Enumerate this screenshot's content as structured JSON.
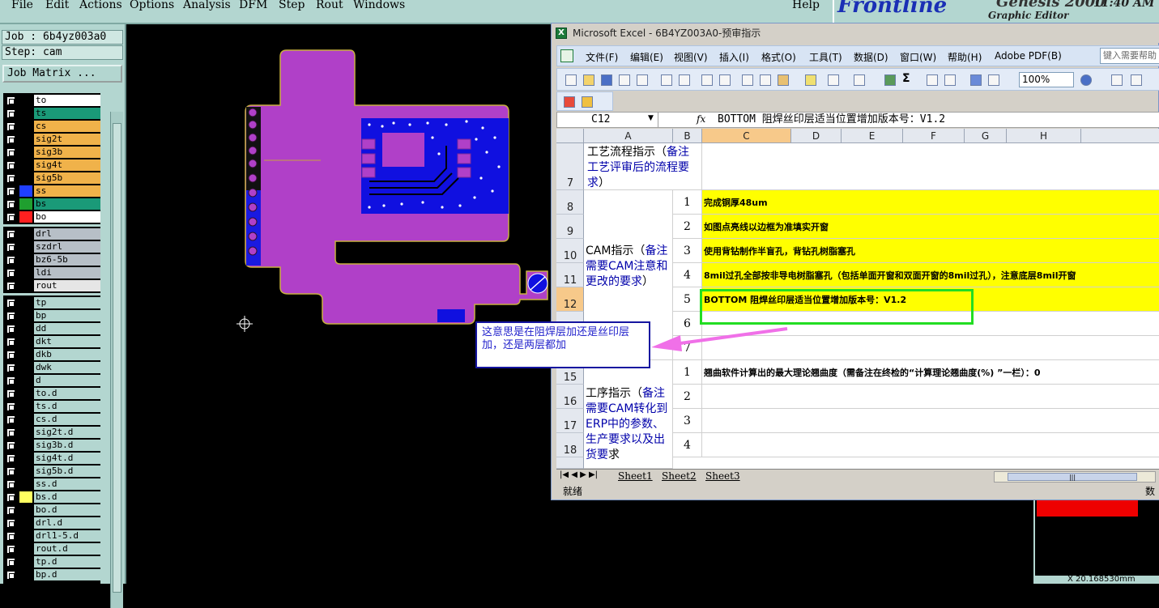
{
  "genesis": {
    "menus": [
      "File",
      "Edit",
      "Actions",
      "Options",
      "Analysis",
      "DFM",
      "Step",
      "Rout",
      "Windows"
    ],
    "help": "Help",
    "logo": "Frontline",
    "version": "Genesis 2000",
    "subtitle": "Graphic Editor",
    "time": "11:40 AM",
    "job_field": "Job : 6b4yz003a0",
    "step_field": "Step: cam",
    "job_matrix_button": "Job Matrix ...",
    "coordinate": "X  20.168530mm"
  },
  "layers_board": [
    {
      "name": "to",
      "color": "#ffffff",
      "swatch": "#000000",
      "mark": "✎"
    },
    {
      "name": "ts",
      "color": "#1a9a78",
      "swatch": "#000000",
      "mark": ""
    },
    {
      "name": "cs",
      "color": "#f0b24a",
      "swatch": "#000000",
      "mark": ""
    },
    {
      "name": "sig2t",
      "color": "#f0b24a",
      "swatch": "#000000",
      "mark": ""
    },
    {
      "name": "sig3b",
      "color": "#f0b24a",
      "swatch": "#000000",
      "mark": ""
    },
    {
      "name": "sig4t",
      "color": "#f0b24a",
      "swatch": "#000000",
      "mark": ""
    },
    {
      "name": "sig5b",
      "color": "#f0b24a",
      "swatch": "#000000",
      "mark": ""
    },
    {
      "name": "ss",
      "color": "#f0b24a",
      "swatch": "#1f3fff",
      "mark": ""
    },
    {
      "name": "bs",
      "color": "#1a9a78",
      "swatch": "#1f9f2f",
      "mark": ""
    },
    {
      "name": "bo",
      "color": "#ffffff",
      "swatch": "#ff2020",
      "mark": "▪"
    }
  ],
  "layers_drill": [
    {
      "name": "drl",
      "color": "#b7bfc7"
    },
    {
      "name": "szdrl",
      "color": "#b7bfc7"
    },
    {
      "name": "bz6-5b",
      "color": "#b7bfc7"
    },
    {
      "name": "ldi",
      "color": "#b7bfc7"
    },
    {
      "name": "rout",
      "color": "#e6e6e6"
    }
  ],
  "layers_misc": [
    {
      "name": "tp",
      "swatch": "#000000",
      "mark": ""
    },
    {
      "name": "bp",
      "swatch": "#000000",
      "mark": ""
    },
    {
      "name": "dd",
      "swatch": "#000000",
      "mark": ""
    },
    {
      "name": "dkt",
      "swatch": "#000000",
      "mark": ""
    },
    {
      "name": "dkb",
      "swatch": "#000000",
      "mark": ""
    },
    {
      "name": "dwk",
      "swatch": "#000000",
      "mark": ""
    },
    {
      "name": "d",
      "swatch": "#000000",
      "mark": ""
    },
    {
      "name": "to.d",
      "swatch": "#000000",
      "mark": "✎"
    },
    {
      "name": "ts.d",
      "swatch": "#000000",
      "mark": ""
    },
    {
      "name": "cs.d",
      "swatch": "#000000",
      "mark": ""
    },
    {
      "name": "sig2t.d",
      "swatch": "#000000",
      "mark": ""
    },
    {
      "name": "sig3b.d",
      "swatch": "#000000",
      "mark": ""
    },
    {
      "name": "sig4t.d",
      "swatch": "#000000",
      "mark": ""
    },
    {
      "name": "sig5b.d",
      "swatch": "#000000",
      "mark": ""
    },
    {
      "name": "ss.d",
      "swatch": "#000000",
      "mark": ""
    },
    {
      "name": "bs.d",
      "swatch": "#ffff60",
      "mark": ""
    },
    {
      "name": "bo.d",
      "swatch": "#000000",
      "mark": ""
    },
    {
      "name": "drl.d",
      "swatch": "#000000",
      "mark": ""
    },
    {
      "name": "drl1-5.d",
      "swatch": "#000000",
      "mark": ""
    },
    {
      "name": "rout.d",
      "swatch": "#000000",
      "mark": ""
    },
    {
      "name": "tp.d",
      "swatch": "#000000",
      "mark": ""
    },
    {
      "name": "bp.d",
      "swatch": "#000000",
      "mark": ""
    }
  ],
  "excel": {
    "title": "Microsoft Excel - 6B4YZ003A0-预审指示",
    "menus": [
      "文件(F)",
      "编辑(E)",
      "视图(V)",
      "插入(I)",
      "格式(O)",
      "工具(T)",
      "数据(D)",
      "窗口(W)",
      "帮助(H)",
      "Adobe PDF(B)"
    ],
    "help_placeholder": "键入需要帮助",
    "zoom": "100%",
    "name_box": "C12",
    "fx": "fx",
    "formula": "BOTTOM 阻焊丝印层适当位置增加版本号：V1.2",
    "columns": [
      "A",
      "B",
      "C",
      "D",
      "E",
      "F",
      "G",
      "H"
    ],
    "row_headers": [
      "7",
      "8",
      "9",
      "10",
      "11",
      "12",
      "",
      "",
      "15",
      "16",
      "17",
      "18"
    ],
    "section_process": {
      "black": "工艺流程指示（",
      "blue": "备注工艺评审后的流程要求",
      "tail": "）"
    },
    "section_cam": {
      "black": "CAM指示（",
      "blue": "备注需要CAM注意和更改的要求",
      "tail": "）"
    },
    "section_work": {
      "black": "工序指示（",
      "blue": "备注需要CAM转化到ERP中的参数、生产要求以及出货要",
      "tail": "求"
    },
    "cam_rows": [
      {
        "n": "1",
        "text": "完成铜厚48um",
        "yellow": true
      },
      {
        "n": "2",
        "text": "如图点亮线以边框为准填实开窗",
        "yellow": true
      },
      {
        "n": "3",
        "text": "使用背钻制作半盲孔，背钻孔树脂塞孔",
        "yellow": true
      },
      {
        "n": "4",
        "text": "8mil过孔全部按非导电树脂塞孔（包括单面开窗和双面开窗的8mil过孔），注意底层8mil开窗",
        "yellow": true
      },
      {
        "n": "5",
        "text": "BOTTOM 阻焊丝印层适当位置增加版本号：V1.2",
        "yellow": true
      },
      {
        "n": "6",
        "text": "",
        "yellow": false
      },
      {
        "n": "7",
        "text": "",
        "yellow": false
      }
    ],
    "work_rows": [
      {
        "n": "1",
        "text": "翘曲软件计算出的最大理论翘曲度（需备注在终检的“计算理论翘曲度(%) ”一栏）：0"
      },
      {
        "n": "2",
        "text": ""
      },
      {
        "n": "3",
        "text": ""
      },
      {
        "n": "4",
        "text": ""
      }
    ],
    "sheets": [
      "Sheet1",
      "Sheet2",
      "Sheet3"
    ],
    "status": "就绪",
    "status_right": "数"
  },
  "callout": "这意思是在阻焊层加还是丝印层加，还是两层都加",
  "colors": {
    "board": "#b040c8",
    "copper": "#1010e0",
    "highlight": "#22dd22",
    "callout_border": "#1515a0"
  }
}
